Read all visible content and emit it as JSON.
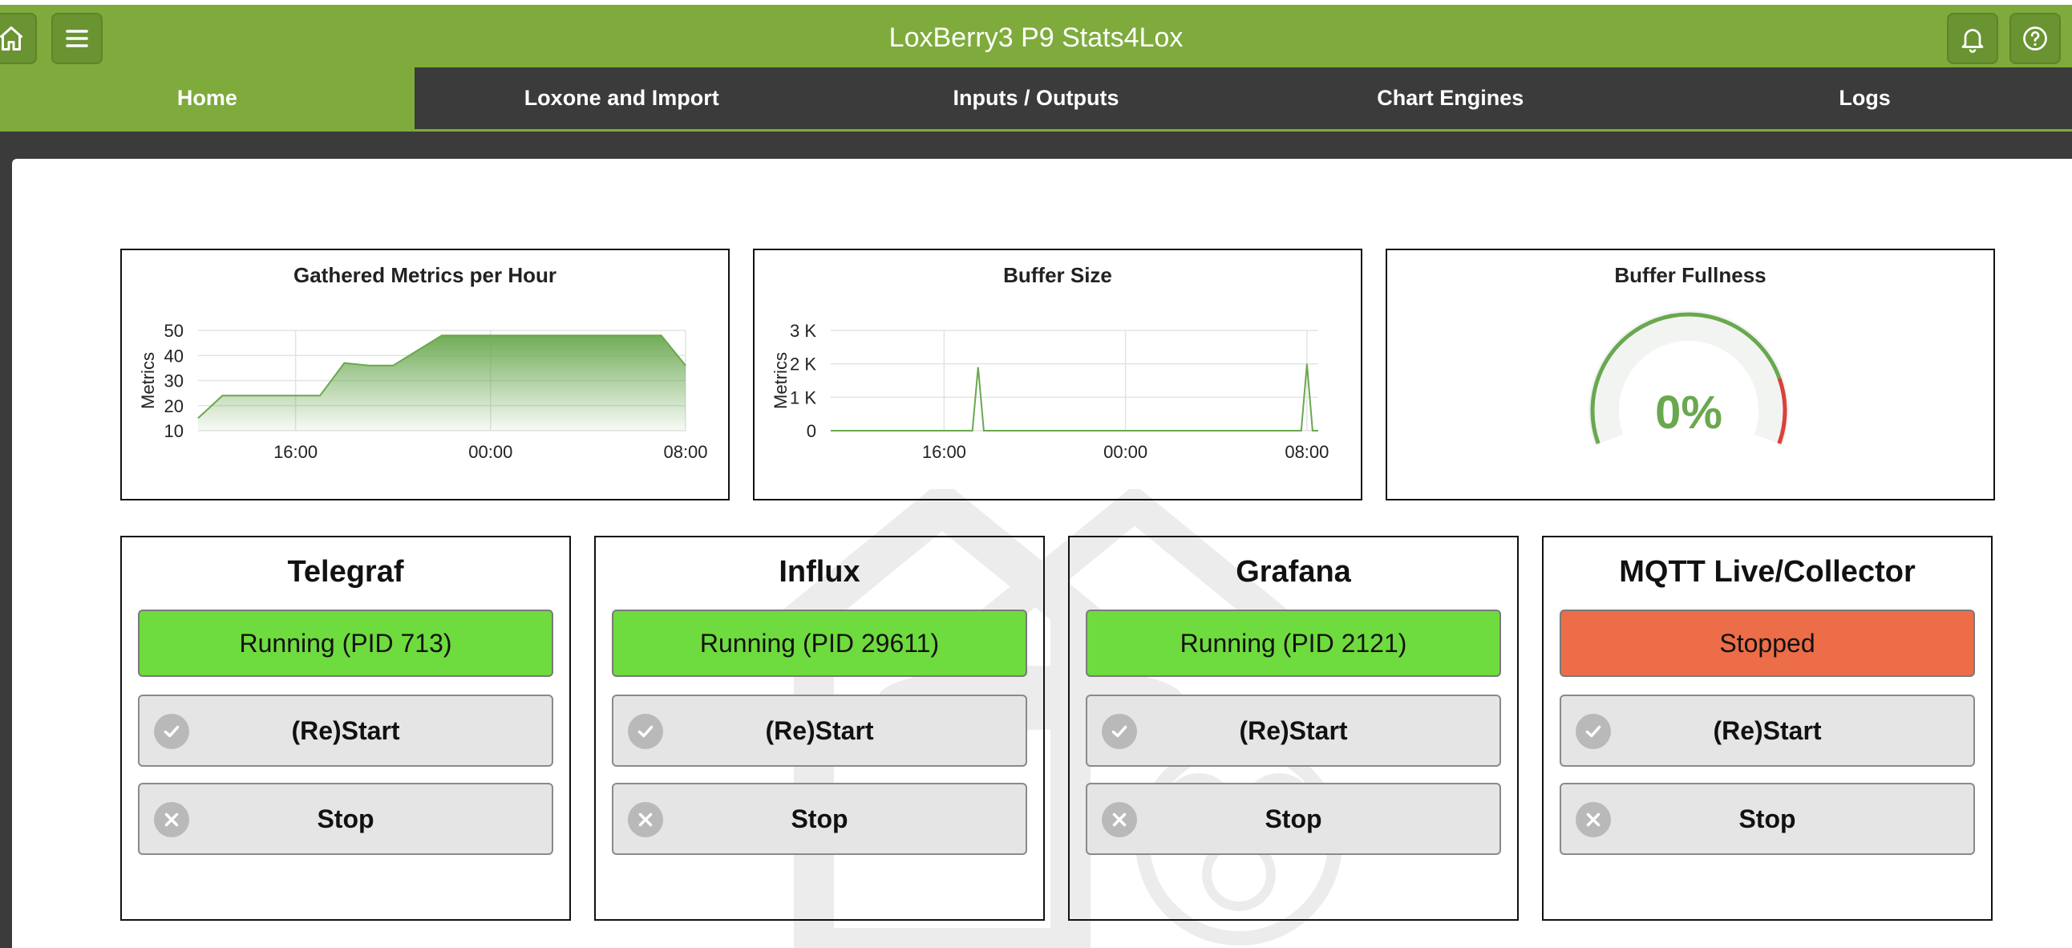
{
  "header": {
    "title": "LoxBerry3 P9 Stats4Lox",
    "icons": [
      "home-icon",
      "menu-icon",
      "bell-icon",
      "help-icon"
    ]
  },
  "tabs": [
    {
      "label": "Home",
      "active": true
    },
    {
      "label": "Loxone and Import",
      "active": false
    },
    {
      "label": "Inputs / Outputs",
      "active": false
    },
    {
      "label": "Chart Engines",
      "active": false
    },
    {
      "label": "Logs",
      "active": false
    }
  ],
  "colors": {
    "brand": "#7eab3c",
    "running": "#6edb3e",
    "stopped": "#ec6d48",
    "gauge": "#6aa84f",
    "gauge_alert": "#d9423a"
  },
  "panels": {
    "metrics": {
      "title": "Gathered Metrics per Hour"
    },
    "buffer": {
      "title": "Buffer Size"
    },
    "fullness": {
      "title": "Buffer Fullness"
    }
  },
  "chart_data": [
    {
      "type": "area",
      "title": "Gathered Metrics per Hour",
      "ylabel": "Metrics",
      "xlabel": "",
      "x_ticks": [
        "16:00",
        "00:00",
        "08:00"
      ],
      "y_ticks": [
        "10",
        "20",
        "30",
        "40",
        "50"
      ],
      "ylim": [
        10,
        50
      ],
      "x": [
        "12:00",
        "13:00",
        "14:00",
        "15:00",
        "16:00",
        "17:00",
        "18:00",
        "19:00",
        "20:00",
        "21:00",
        "22:00",
        "23:00",
        "00:00",
        "01:00",
        "02:00",
        "03:00",
        "04:00",
        "05:00",
        "06:00",
        "07:00",
        "08:00"
      ],
      "values": [
        15,
        24,
        24,
        24,
        24,
        24,
        37,
        36,
        36,
        42,
        48,
        48,
        48,
        48,
        48,
        48,
        48,
        48,
        48,
        48,
        36
      ],
      "grid": true
    },
    {
      "type": "line",
      "title": "Buffer Size",
      "ylabel": "Metrics",
      "xlabel": "",
      "x_ticks": [
        "16:00",
        "00:00",
        "08:00"
      ],
      "y_ticks": [
        "0",
        "1 K",
        "2 K",
        "3 K"
      ],
      "ylim": [
        0,
        3000
      ],
      "x": [
        "11:00",
        "16:00",
        "17:15",
        "17:30",
        "17:45",
        "00:00",
        "07:45",
        "08:00",
        "08:15",
        "08:30"
      ],
      "values": [
        0,
        0,
        0,
        1900,
        0,
        0,
        0,
        2000,
        0,
        0
      ],
      "grid": true
    }
  ],
  "gauge": {
    "value": 0,
    "label": "0%"
  },
  "services": [
    {
      "name": "Telegraf",
      "status": "Running (PID 713)",
      "state": "running",
      "restart": "(Re)Start",
      "stop": "Stop"
    },
    {
      "name": "Influx",
      "status": "Running (PID 29611)",
      "state": "running",
      "restart": "(Re)Start",
      "stop": "Stop"
    },
    {
      "name": "Grafana",
      "status": "Running (PID 2121)",
      "state": "running",
      "restart": "(Re)Start",
      "stop": "Stop"
    },
    {
      "name": "MQTT Live/Collector",
      "status": "Stopped",
      "state": "stopped",
      "restart": "(Re)Start",
      "stop": "Stop"
    }
  ]
}
